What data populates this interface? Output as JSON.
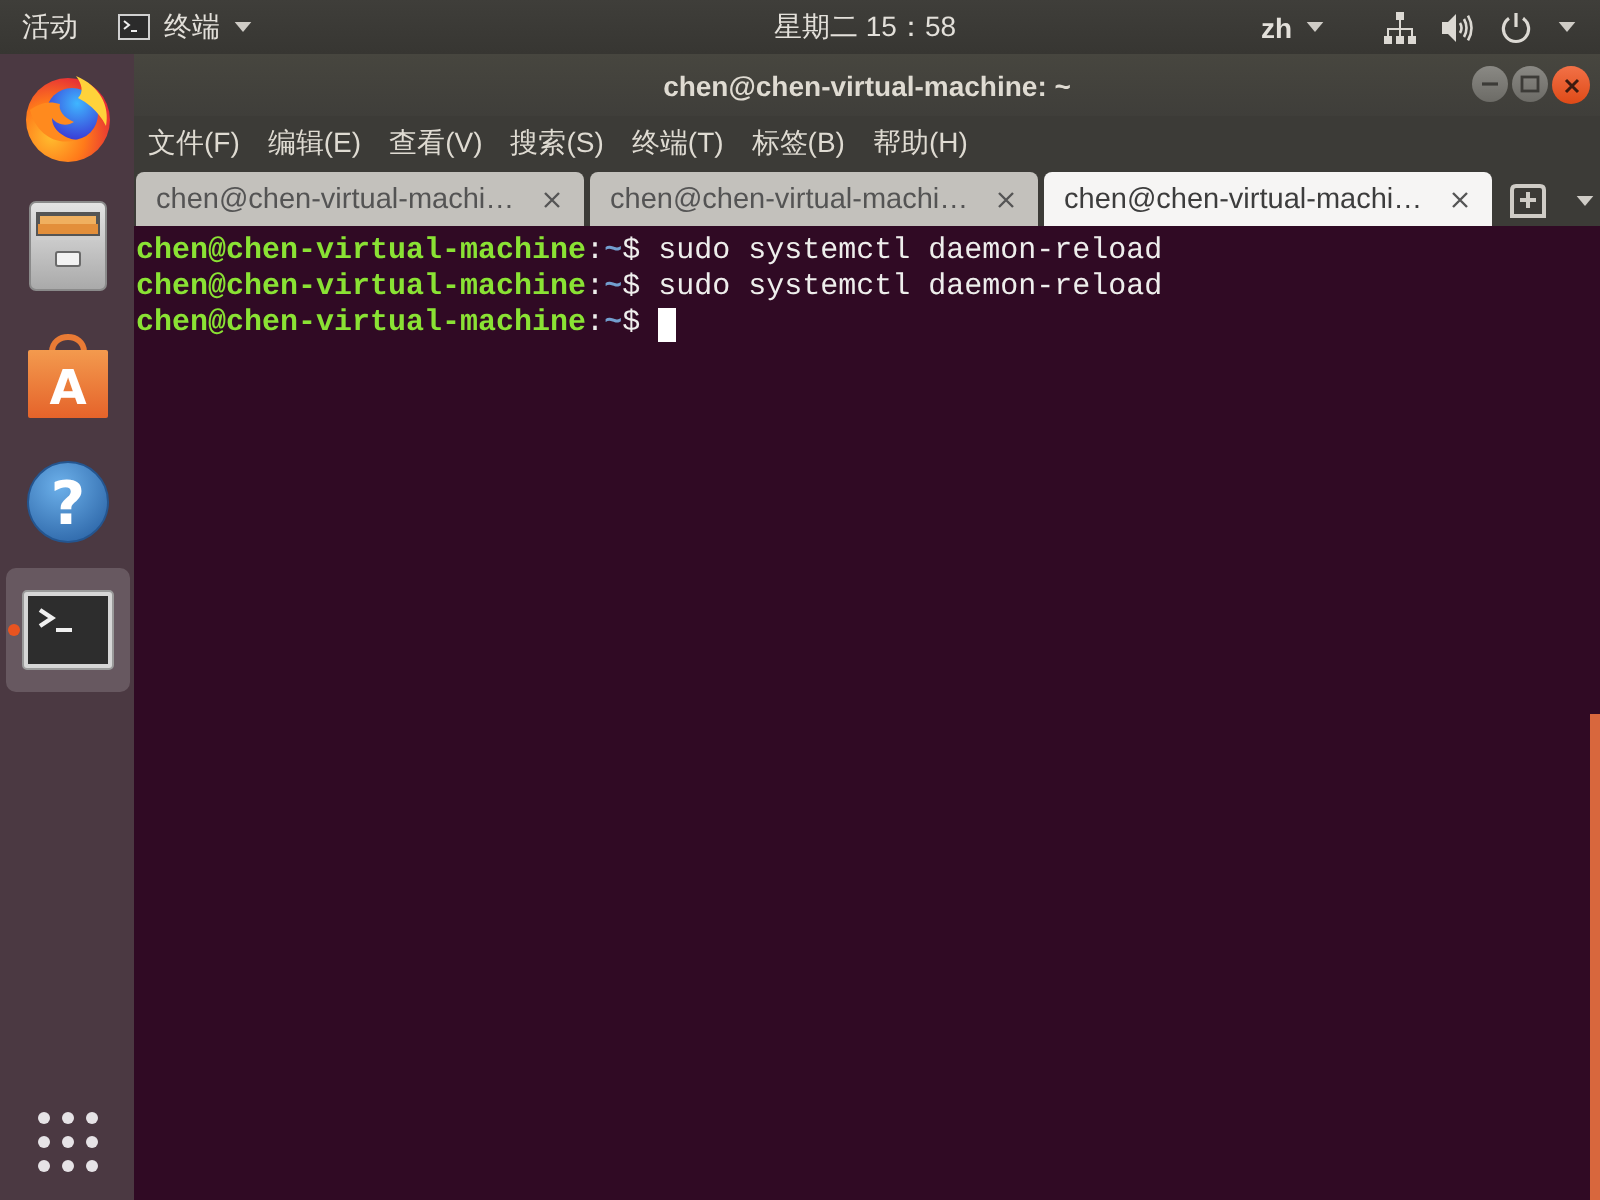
{
  "top_bar": {
    "activities": "活动",
    "app_menu": "终端",
    "clock": "星期二 15：58",
    "input_method": "zh"
  },
  "dock": {
    "items": [
      {
        "kind": "firefox",
        "selected": false,
        "running": false
      },
      {
        "kind": "files",
        "selected": false,
        "running": false
      },
      {
        "kind": "software",
        "glyph": "A",
        "selected": false,
        "running": false
      },
      {
        "kind": "help",
        "glyph": "?",
        "selected": false,
        "running": false
      },
      {
        "kind": "terminal",
        "selected": true,
        "running": true
      }
    ]
  },
  "window": {
    "title": "chen@chen-virtual-machine: ~",
    "menu": [
      "文件(F)",
      "编辑(E)",
      "查看(V)",
      "搜索(S)",
      "终端(T)",
      "标签(B)",
      "帮助(H)"
    ],
    "tabs": [
      {
        "label": "chen@chen-virtual-machi…",
        "selected": false
      },
      {
        "label": "chen@chen-virtual-machi…",
        "selected": false
      },
      {
        "label": "chen@chen-virtual-machi…",
        "selected": true
      }
    ],
    "terminal": {
      "lines": [
        {
          "user": "chen@chen-virtual-machine",
          "separator": ":",
          "path": "~",
          "symbol": "$",
          "command": "sudo systemctl daemon-reload",
          "cursor": false
        },
        {
          "user": "chen@chen-virtual-machine",
          "separator": ":",
          "path": "~",
          "symbol": "$",
          "command": "sudo systemctl daemon-reload",
          "cursor": false
        },
        {
          "user": "chen@chen-virtual-machine",
          "separator": ":",
          "path": "~",
          "symbol": "$",
          "cursor": true
        }
      ]
    }
  }
}
